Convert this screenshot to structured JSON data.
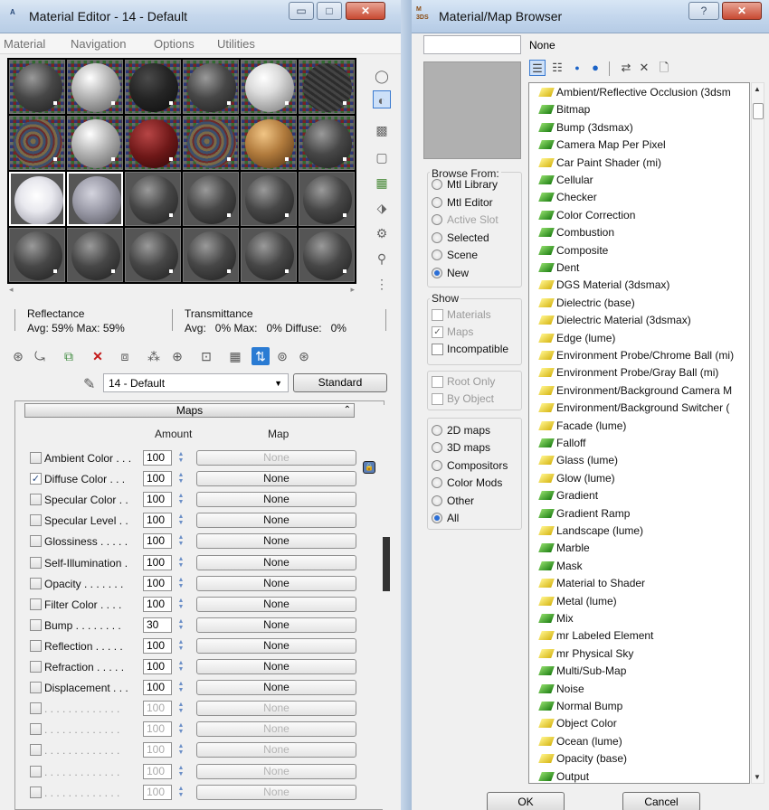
{
  "material_editor": {
    "title": "Material Editor - 14 - Default",
    "app_icon_text": "A",
    "caption_buttons": {
      "minimize": "▭",
      "maximize": "□",
      "close": "✕"
    },
    "menu": [
      "Material",
      "Navigation",
      "Options",
      "Utilities"
    ],
    "stats": {
      "reflectance_label": "Reflectance",
      "reflectance_values": "Avg: 59% Max: 59%",
      "transmittance_label": "Transmittance",
      "transmittance_values": "Avg:   0% Max:   0% Diffuse:   0%"
    },
    "material_name": "14 - Default",
    "material_type": "Standard",
    "maps": {
      "title": "Maps",
      "amount_header": "Amount",
      "map_header": "Map",
      "rows": [
        {
          "name": "Ambient Color . . .",
          "amount": "100",
          "map": "None",
          "checked": false,
          "enabled": true,
          "map_disabled": true
        },
        {
          "name": "Diffuse Color . . .",
          "amount": "100",
          "map": "None",
          "checked": true,
          "enabled": true,
          "map_disabled": false
        },
        {
          "name": "Specular Color . .",
          "amount": "100",
          "map": "None",
          "checked": false,
          "enabled": true,
          "map_disabled": false
        },
        {
          "name": "Specular Level . .",
          "amount": "100",
          "map": "None",
          "checked": false,
          "enabled": true,
          "map_disabled": false
        },
        {
          "name": "Glossiness . . . . .",
          "amount": "100",
          "map": "None",
          "checked": false,
          "enabled": true,
          "map_disabled": false
        },
        {
          "name": "Self-Illumination .",
          "amount": "100",
          "map": "None",
          "checked": false,
          "enabled": true,
          "map_disabled": false
        },
        {
          "name": "Opacity . . . . . . .",
          "amount": "100",
          "map": "None",
          "checked": false,
          "enabled": true,
          "map_disabled": false
        },
        {
          "name": "Filter Color . . . .",
          "amount": "100",
          "map": "None",
          "checked": false,
          "enabled": true,
          "map_disabled": false
        },
        {
          "name": "Bump . . . . . . . .",
          "amount": "30",
          "map": "None",
          "checked": false,
          "enabled": true,
          "map_disabled": false
        },
        {
          "name": "Reflection . . . . .",
          "amount": "100",
          "map": "None",
          "checked": false,
          "enabled": true,
          "map_disabled": false
        },
        {
          "name": "Refraction . . . . .",
          "amount": "100",
          "map": "None",
          "checked": false,
          "enabled": true,
          "map_disabled": false
        },
        {
          "name": "Displacement . . .",
          "amount": "100",
          "map": "None",
          "checked": false,
          "enabled": true,
          "map_disabled": false
        },
        {
          "name": ". . . . . . . . . . . . .",
          "amount": "100",
          "map": "None",
          "checked": false,
          "enabled": false,
          "map_disabled": true
        },
        {
          "name": ". . . . . . . . . . . . .",
          "amount": "100",
          "map": "None",
          "checked": false,
          "enabled": false,
          "map_disabled": true
        },
        {
          "name": ". . . . . . . . . . . . .",
          "amount": "100",
          "map": "None",
          "checked": false,
          "enabled": false,
          "map_disabled": true
        },
        {
          "name": ". . . . . . . . . . . . .",
          "amount": "100",
          "map": "None",
          "checked": false,
          "enabled": false,
          "map_disabled": true
        },
        {
          "name": ". . . . . . . . . . . . .",
          "amount": "100",
          "map": "None",
          "checked": false,
          "enabled": false,
          "map_disabled": true
        }
      ]
    }
  },
  "browser": {
    "title": "Material/Map Browser",
    "app_icon_text": "M\n3DS",
    "caption_buttons": {
      "help": "?",
      "close": "✕"
    },
    "filter_value": "",
    "current": "None",
    "browse_from": {
      "label": "Browse From:",
      "options": [
        {
          "label": "Mtl Library",
          "selected": false,
          "enabled": true
        },
        {
          "label": "Mtl Editor",
          "selected": false,
          "enabled": true
        },
        {
          "label": "Active Slot",
          "selected": false,
          "enabled": false
        },
        {
          "label": "Selected",
          "selected": false,
          "enabled": true
        },
        {
          "label": "Scene",
          "selected": false,
          "enabled": true
        },
        {
          "label": "New",
          "selected": true,
          "enabled": true
        }
      ]
    },
    "show": {
      "label": "Show",
      "options": [
        {
          "label": "Materials",
          "checked": false,
          "enabled": false
        },
        {
          "label": "Maps",
          "checked": true,
          "enabled": false
        },
        {
          "label": "Incompatible",
          "checked": false,
          "enabled": true
        }
      ]
    },
    "root_options": [
      {
        "label": "Root Only",
        "checked": false
      },
      {
        "label": "By Object",
        "checked": false
      }
    ],
    "map_types": [
      {
        "label": "2D maps",
        "selected": false
      },
      {
        "label": "3D maps",
        "selected": false
      },
      {
        "label": "Compositors",
        "selected": false
      },
      {
        "label": "Color Mods",
        "selected": false
      },
      {
        "label": "Other",
        "selected": false
      },
      {
        "label": "All",
        "selected": true
      }
    ],
    "items": [
      {
        "label": "Ambient/Reflective Occlusion (3dsm",
        "color": "y"
      },
      {
        "label": "Bitmap",
        "color": "g"
      },
      {
        "label": "Bump (3dsmax)",
        "color": "g"
      },
      {
        "label": "Camera Map Per Pixel",
        "color": "g"
      },
      {
        "label": "Car Paint Shader (mi)",
        "color": "y"
      },
      {
        "label": "Cellular",
        "color": "g"
      },
      {
        "label": "Checker",
        "color": "g"
      },
      {
        "label": "Color Correction",
        "color": "g"
      },
      {
        "label": "Combustion",
        "color": "g"
      },
      {
        "label": "Composite",
        "color": "g"
      },
      {
        "label": "Dent",
        "color": "g"
      },
      {
        "label": "DGS Material (3dsmax)",
        "color": "y"
      },
      {
        "label": "Dielectric (base)",
        "color": "y"
      },
      {
        "label": "Dielectric Material (3dsmax)",
        "color": "y"
      },
      {
        "label": "Edge (lume)",
        "color": "y"
      },
      {
        "label": "Environment Probe/Chrome Ball (mi)",
        "color": "y"
      },
      {
        "label": "Environment Probe/Gray Ball (mi)",
        "color": "y"
      },
      {
        "label": "Environment/Background Camera M",
        "color": "y"
      },
      {
        "label": "Environment/Background Switcher (",
        "color": "y"
      },
      {
        "label": "Facade (lume)",
        "color": "y"
      },
      {
        "label": "Falloff",
        "color": "g"
      },
      {
        "label": "Glass (lume)",
        "color": "y"
      },
      {
        "label": "Glow (lume)",
        "color": "y"
      },
      {
        "label": "Gradient",
        "color": "g"
      },
      {
        "label": "Gradient Ramp",
        "color": "g"
      },
      {
        "label": "Landscape (lume)",
        "color": "y"
      },
      {
        "label": "Marble",
        "color": "g"
      },
      {
        "label": "Mask",
        "color": "g"
      },
      {
        "label": "Material to Shader",
        "color": "y"
      },
      {
        "label": "Metal (lume)",
        "color": "y"
      },
      {
        "label": "Mix",
        "color": "g"
      },
      {
        "label": "mr Labeled Element",
        "color": "y"
      },
      {
        "label": "mr Physical Sky",
        "color": "y"
      },
      {
        "label": "Multi/Sub-Map",
        "color": "g"
      },
      {
        "label": "Noise",
        "color": "g"
      },
      {
        "label": "Normal Bump",
        "color": "g"
      },
      {
        "label": "Object Color",
        "color": "y"
      },
      {
        "label": "Ocean (lume)",
        "color": "y"
      },
      {
        "label": "Opacity (base)",
        "color": "y"
      },
      {
        "label": "Output",
        "color": "g"
      }
    ],
    "ok_label": "OK",
    "cancel_label": "Cancel"
  },
  "colors": {
    "selection_blue": "#2b6ed6",
    "titlebar": "#c5d7ec",
    "close_red": "#c84a32"
  }
}
